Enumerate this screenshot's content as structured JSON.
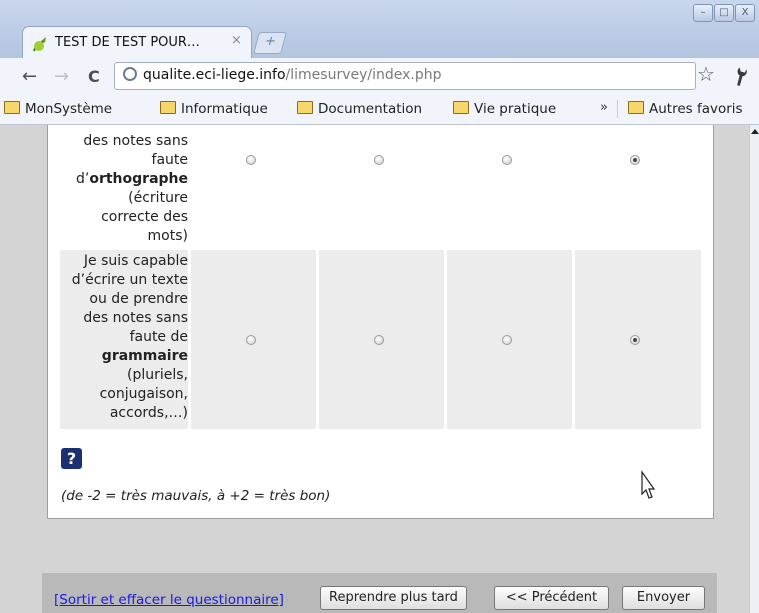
{
  "browser": {
    "tab_title": "TEST DE TEST POUR…",
    "tab_close": "×",
    "new_tab": "+",
    "window_buttons": [
      "–",
      "□",
      "X"
    ],
    "nav": {
      "back": "←",
      "forward": "→",
      "reload": "C"
    },
    "url_host": "qualite.eci-liege.info",
    "url_path": "/limesurvey/index.php",
    "star": "☆",
    "wrench": "🔧"
  },
  "bookmarks": [
    "MonSystème",
    "Informatique",
    "Documentation",
    "Vie pratique",
    "»",
    "Autres favoris"
  ],
  "survey": {
    "question1": {
      "lines_before": [
        "des notes sans",
        "faute"
      ],
      "bold_prefix": "d’",
      "bold_word": "orthographe",
      "lines_after": [
        "(écriture",
        "correcte des",
        "mots)"
      ],
      "selected_index": 3
    },
    "question2": {
      "lines_before": [
        "Je suis capable",
        "d’écrire un texte",
        "ou de prendre",
        "des notes sans",
        "faute de"
      ],
      "bold_word": "grammaire",
      "lines_after": [
        "(pluriels,",
        "conjugaison,",
        "accords,…)"
      ],
      "selected_index": 3
    },
    "help_icon": "?",
    "scale_note": "(de -2 = très mauvais, à +2 = très bon)"
  },
  "footer": {
    "exit_link": "[Sortir et effacer le questionnaire]",
    "resume_later": "Reprendre plus tard",
    "previous": "<< Précédent",
    "submit": "Envoyer"
  }
}
